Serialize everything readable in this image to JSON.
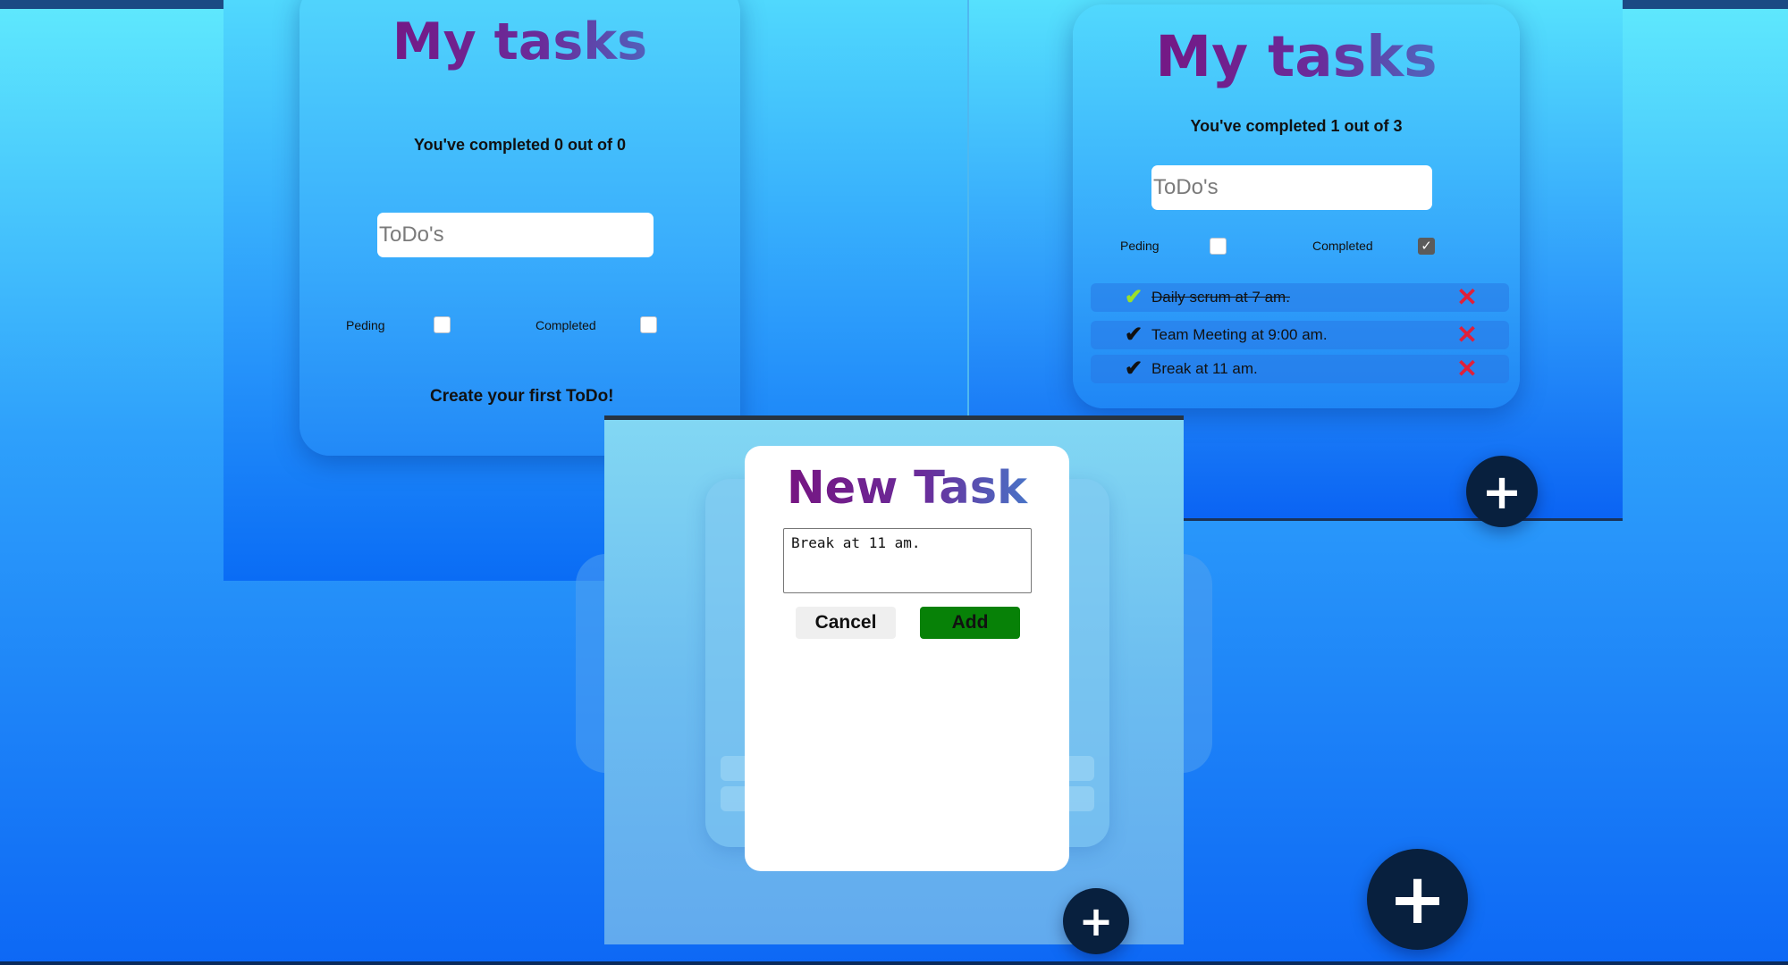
{
  "screen1": {
    "title": "My tasks",
    "summary": "You've completed 0 out of 0",
    "search_placeholder": "ToDo's",
    "filters": {
      "pending_label": "Peding",
      "completed_label": "Completed"
    },
    "empty_message": "Create your first ToDo!"
  },
  "screen2": {
    "title": "My tasks",
    "summary": "You've completed 1 out of 3",
    "search_placeholder": "ToDo's",
    "filters": {
      "pending_label": "Peding",
      "completed_label": "Completed"
    },
    "tasks": [
      {
        "text": "Daily scrum at 7 am.",
        "completed": true
      },
      {
        "text": "Team Meeting at 9:00 am.",
        "completed": false
      },
      {
        "text": "Break at 11 am.",
        "completed": false
      }
    ],
    "icons": {
      "check": "✔",
      "delete": "✕"
    },
    "colors": {
      "completed_check": "#9be02a",
      "pending_check": "#111111",
      "delete": "#e0203a"
    }
  },
  "modal": {
    "title": "New Task",
    "textarea_value": "Break at 11 am.",
    "cancel_label": "Cancel",
    "add_label": "Add",
    "colors": {
      "add": "#078107"
    }
  },
  "fab": {
    "label": "+"
  }
}
